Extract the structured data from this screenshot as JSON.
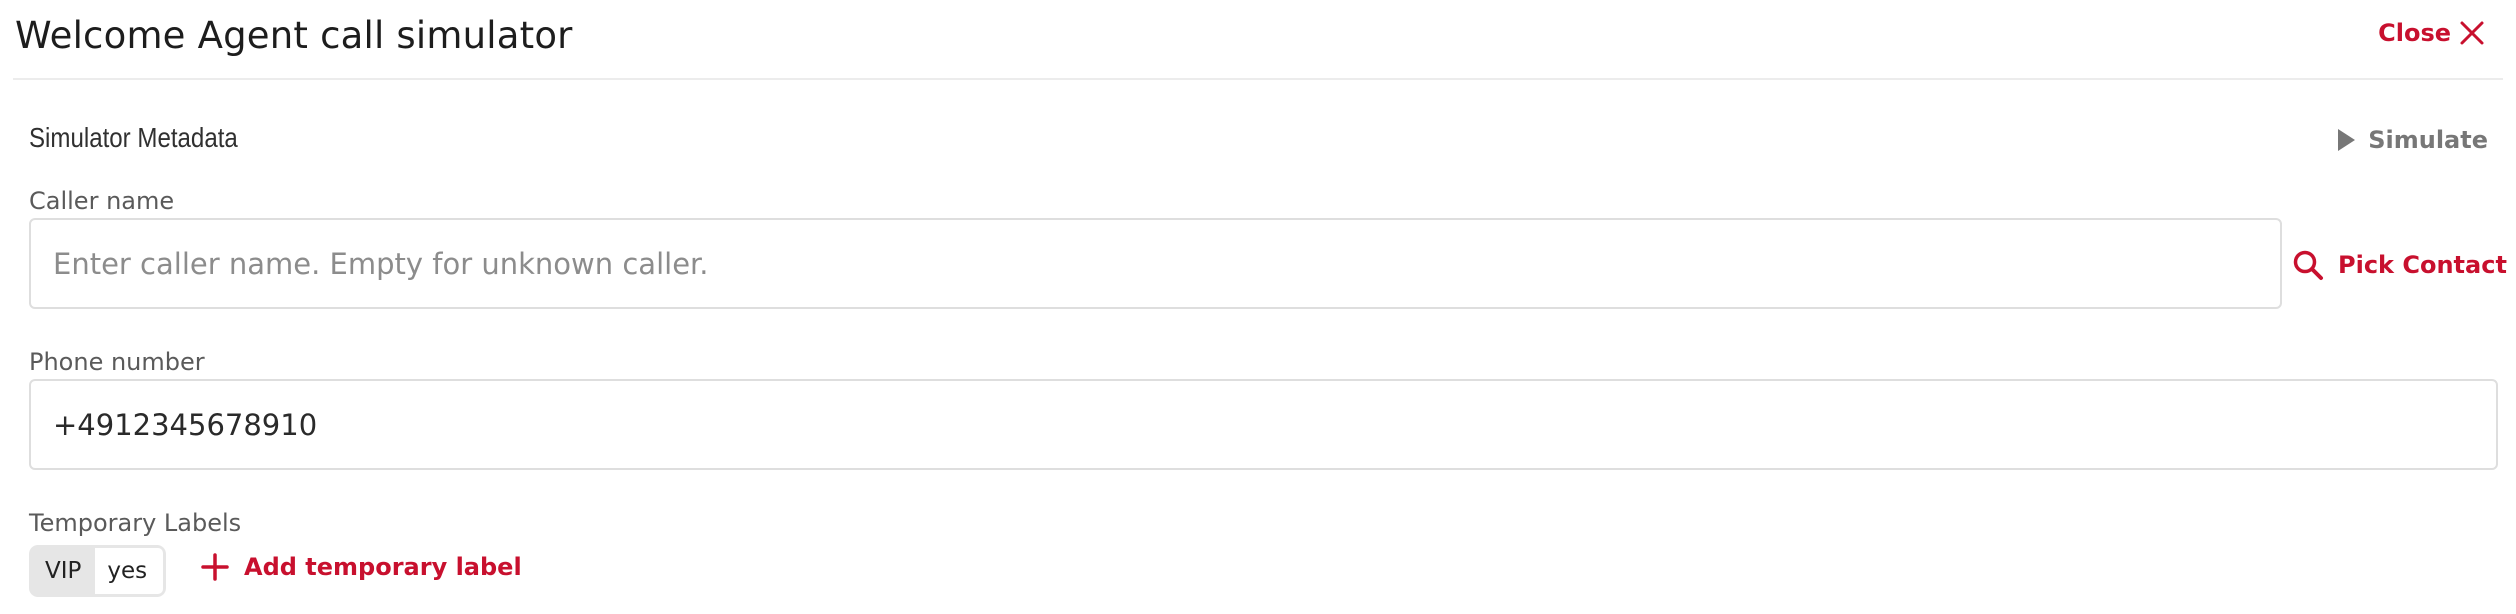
{
  "header": {
    "title": "Welcome Agent call simulator",
    "close_label": "Close",
    "close_icon": "close-icon"
  },
  "section": {
    "title": "Simulator Metadata",
    "simulate_label": "Simulate",
    "simulate_icon": "play-icon"
  },
  "caller": {
    "label": "Caller name",
    "value": "",
    "placeholder": "Enter caller name. Empty for unknown caller.",
    "pick_contact_label": "Pick Contact",
    "pick_contact_icon": "search-icon"
  },
  "phone": {
    "label": "Phone number",
    "value": "+4912345678910"
  },
  "labels": {
    "label": "Temporary Labels",
    "items": [
      {
        "key": "VIP",
        "value": "yes"
      }
    ],
    "add_label": "Add temporary label",
    "add_icon": "plus-icon"
  },
  "colors": {
    "accent": "#c8102e",
    "muted_action": "#777777",
    "border": "#dedede",
    "chip_bg": "#e6e6e6"
  }
}
